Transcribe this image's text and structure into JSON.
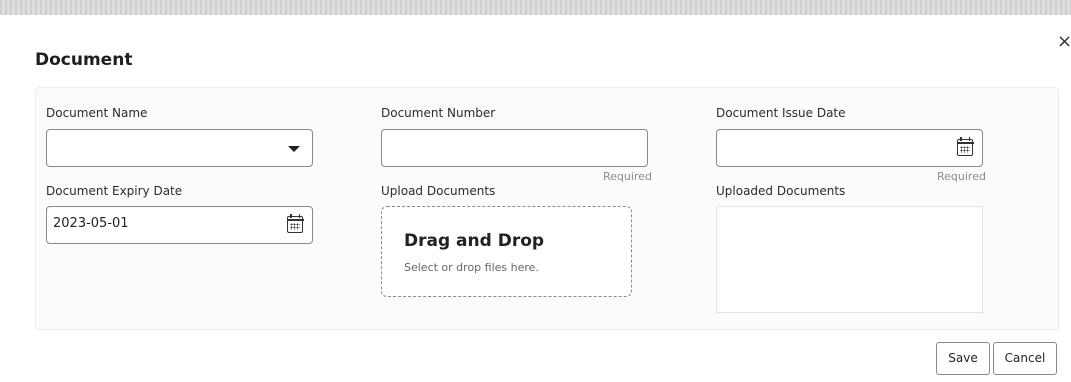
{
  "dialog": {
    "title": "Document",
    "close_glyph": "×"
  },
  "form": {
    "document_name": {
      "label": "Document Name",
      "value": ""
    },
    "document_number": {
      "label": "Document Number",
      "value": "",
      "required_text": "Required"
    },
    "document_issue_date": {
      "label": "Document Issue Date",
      "value": "",
      "required_text": "Required"
    },
    "document_expiry_date": {
      "label": "Document Expiry Date",
      "value": "2023-05-01"
    },
    "upload_documents": {
      "label": "Upload Documents",
      "heading": "Drag and Drop",
      "hint": "Select or drop files here."
    },
    "uploaded_documents": {
      "label": "Uploaded Documents"
    }
  },
  "footer": {
    "save_label": "Save",
    "cancel_label": "Cancel"
  },
  "icons": {
    "dropdown": "chevron-down-icon",
    "calendar": "calendar-icon",
    "close": "close-icon"
  }
}
